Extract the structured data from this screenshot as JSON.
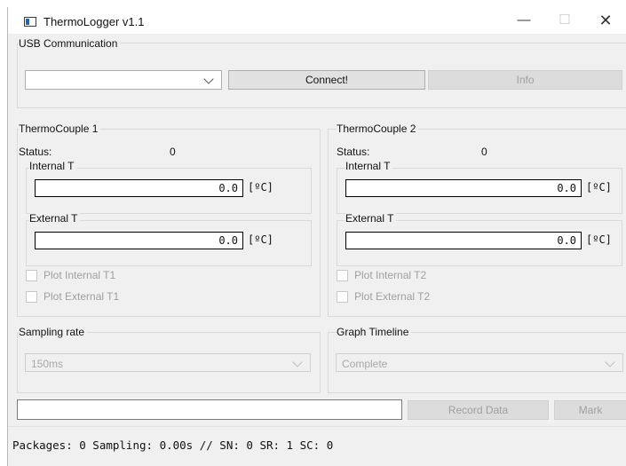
{
  "window": {
    "title": "ThermoLogger v1.1",
    "min_glyph": "—",
    "max_glyph": "☐",
    "close_glyph": "✕"
  },
  "usb": {
    "group_label": "USB Communication",
    "port_value": "",
    "connect_label": "Connect!",
    "info_label": "Info"
  },
  "tc1": {
    "group_label": "ThermoCouple 1",
    "status_label": "Status:",
    "status_value": "0",
    "internal_label": "Internal T",
    "internal_value": "0.0",
    "internal_unit": "[ºC]",
    "external_label": "External T",
    "external_value": "0.0",
    "external_unit": "[ºC]",
    "plot_internal": "Plot Internal T1",
    "plot_external": "Plot External T1"
  },
  "tc2": {
    "group_label": "ThermoCouple 2",
    "status_label": "Status:",
    "status_value": "0",
    "internal_label": "Internal T",
    "internal_value": "0.0",
    "internal_unit": "[ºC]",
    "external_label": "External T",
    "external_value": "0.0",
    "external_unit": "[ºC]",
    "plot_internal": "Plot Internal T2",
    "plot_external": "Plot External T2"
  },
  "sampling": {
    "group_label": "Sampling rate",
    "value": "150ms"
  },
  "timeline": {
    "group_label": "Graph Timeline",
    "value": "Complete"
  },
  "record": {
    "field_value": "",
    "record_label": "Record Data",
    "mark_label": "Mark"
  },
  "status_bar": {
    "text": "Packages: 0 Sampling: 0.00s // SN: 0 SR: 1 SC: 0"
  }
}
